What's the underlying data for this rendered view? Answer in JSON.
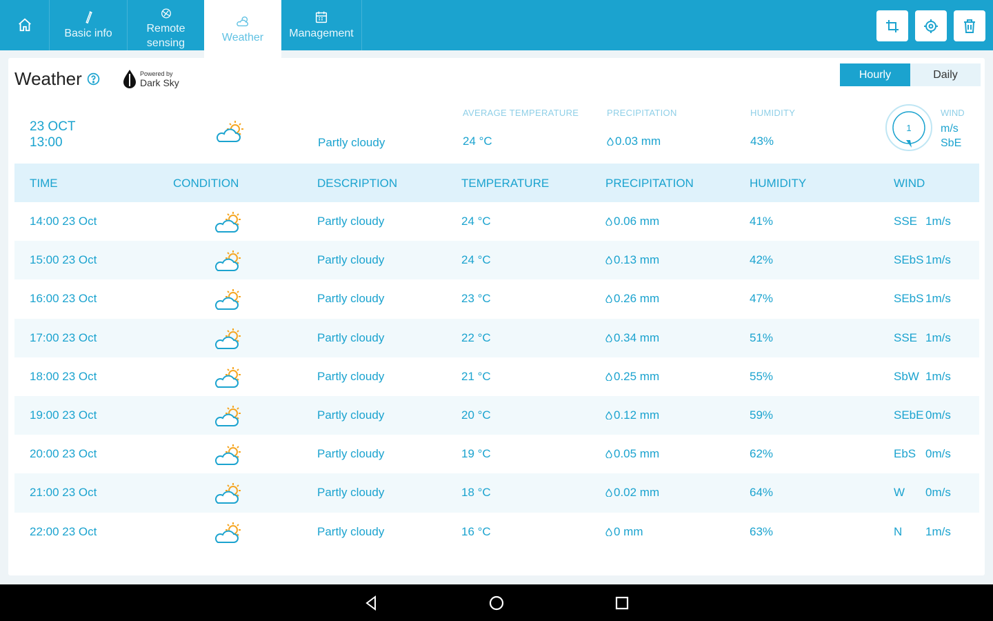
{
  "nav": {
    "tabs": [
      {
        "id": "home",
        "label": "",
        "icon": "home-icon"
      },
      {
        "id": "basic",
        "label": "Basic info",
        "icon": "pen-icon"
      },
      {
        "id": "remote",
        "label": "Remote sensing",
        "line1": "Remote",
        "line2": "sensing",
        "icon": "satellite-icon"
      },
      {
        "id": "weather",
        "label": "Weather",
        "icon": "partly-cloudy-icon",
        "active": true
      },
      {
        "id": "mgmt",
        "label": "Management",
        "icon": "calendar-icon"
      }
    ],
    "actions": [
      "crop-icon",
      "locate-icon",
      "trash-icon"
    ]
  },
  "header": {
    "title": "Weather",
    "powered_small": "Powered by",
    "powered_name": "Dark Sky"
  },
  "toggle": {
    "hourly": "Hourly",
    "daily": "Daily",
    "selected": "Hourly"
  },
  "current": {
    "date": "23 OCT",
    "time": "13:00",
    "description": "Partly cloudy",
    "avg_temp_label": "AVERAGE TEMPERATURE",
    "avg_temp": "24 °C",
    "precip_label": "PRECIPITATION",
    "precip": "0.03 mm",
    "humidity_label": "HUMIDITY",
    "humidity": "43%",
    "wind_label": "WIND",
    "wind_speed": "1",
    "wind_unit": "m/s",
    "wind_dir": "SbE"
  },
  "table": {
    "headers": [
      "TIME",
      "CONDITION",
      "DESCRIPTION",
      "TEMPERATURE",
      "PRECIPITATION",
      "HUMIDITY",
      "WIND"
    ],
    "rows": [
      {
        "time": "14:00 23 Oct",
        "desc": "Partly cloudy",
        "temp": "24 °C",
        "precip": "0.06 mm",
        "hum": "41%",
        "wind_dir": "SSE",
        "wind_spd": "1m/s"
      },
      {
        "time": "15:00 23 Oct",
        "desc": "Partly cloudy",
        "temp": "24 °C",
        "precip": "0.13 mm",
        "hum": "42%",
        "wind_dir": "SEbS",
        "wind_spd": "1m/s"
      },
      {
        "time": "16:00 23 Oct",
        "desc": "Partly cloudy",
        "temp": "23 °C",
        "precip": "0.26 mm",
        "hum": "47%",
        "wind_dir": "SEbS",
        "wind_spd": "1m/s"
      },
      {
        "time": "17:00 23 Oct",
        "desc": "Partly cloudy",
        "temp": "22 °C",
        "precip": "0.34 mm",
        "hum": "51%",
        "wind_dir": "SSE",
        "wind_spd": "1m/s"
      },
      {
        "time": "18:00 23 Oct",
        "desc": "Partly cloudy",
        "temp": "21 °C",
        "precip": "0.25 mm",
        "hum": "55%",
        "wind_dir": "SbW",
        "wind_spd": "1m/s"
      },
      {
        "time": "19:00 23 Oct",
        "desc": "Partly cloudy",
        "temp": "20 °C",
        "precip": "0.12 mm",
        "hum": "59%",
        "wind_dir": "SEbE",
        "wind_spd": "0m/s"
      },
      {
        "time": "20:00 23 Oct",
        "desc": "Partly cloudy",
        "temp": "19 °C",
        "precip": "0.05 mm",
        "hum": "62%",
        "wind_dir": "EbS",
        "wind_spd": "0m/s"
      },
      {
        "time": "21:00 23 Oct",
        "desc": "Partly cloudy",
        "temp": "18 °C",
        "precip": "0.02 mm",
        "hum": "64%",
        "wind_dir": "W",
        "wind_spd": "0m/s"
      },
      {
        "time": "22:00 23 Oct",
        "desc": "Partly cloudy",
        "temp": "16 °C",
        "precip": "0 mm",
        "hum": "63%",
        "wind_dir": "N",
        "wind_spd": "1m/s"
      }
    ]
  },
  "system_nav": [
    "back-icon",
    "home-circle-icon",
    "recents-icon"
  ],
  "colors": {
    "primary": "#1ba3cf",
    "header_row": "#dff2fb",
    "alt_row": "#f1f9fc",
    "label_light": "#8fcfe7",
    "sun": "#f5a623"
  }
}
